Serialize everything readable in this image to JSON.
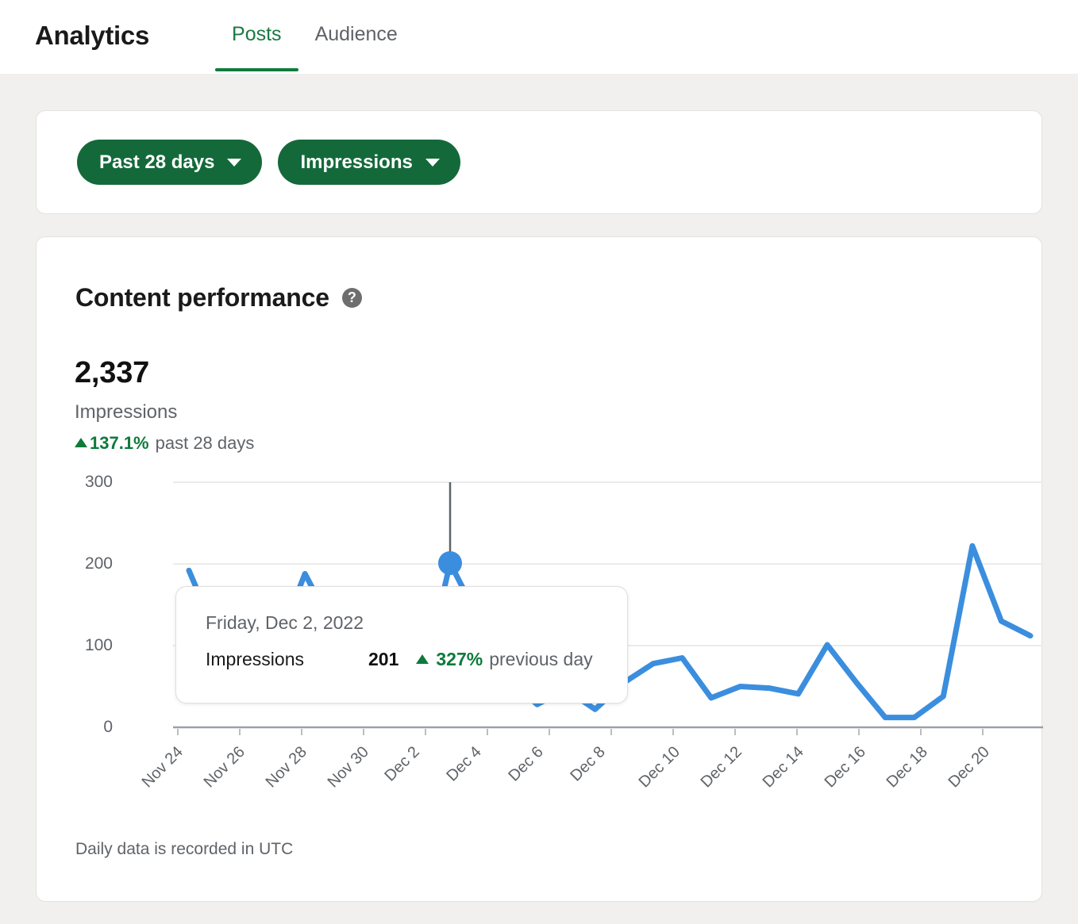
{
  "header": {
    "title": "Analytics",
    "tabs": [
      {
        "label": "Posts",
        "active": true
      },
      {
        "label": "Audience",
        "active": false
      }
    ]
  },
  "filters": {
    "date_range": {
      "label": "Past 28 days",
      "icon": "chevron-down-icon"
    },
    "metric": {
      "label": "Impressions",
      "icon": "chevron-down-icon"
    }
  },
  "performance": {
    "title": "Content performance",
    "help_icon": "help-circle-icon",
    "value": "2,337",
    "metric_label": "Impressions",
    "delta_arrow": "triangle-up-icon",
    "delta_percent": "137.1%",
    "delta_period": "past 28 days",
    "footnote": "Daily data is recorded in UTC"
  },
  "tooltip": {
    "date": "Friday, Dec 2, 2022",
    "metric_label": "Impressions",
    "value": "201",
    "arrow": "triangle-up-icon",
    "delta": "327%",
    "suffix": "previous day"
  },
  "colors": {
    "brand_green": "#14693a",
    "tab_active": "#0f7b3e",
    "line_blue": "#3b8ede",
    "positive_green": "#0e7a3c",
    "page_bg": "#f1f0ee",
    "card_bg": "#ffffff",
    "grid": "#ebebeb",
    "axis": "#9aa0a6",
    "muted_text": "#5f6368"
  },
  "chart_data": {
    "type": "line",
    "title": "Content performance",
    "xlabel": "",
    "ylabel": "Impressions",
    "ylim": [
      0,
      300
    ],
    "yticks": [
      0,
      100,
      200,
      300
    ],
    "grid": true,
    "legend": "none",
    "series": [
      {
        "name": "Impressions",
        "color": "#3b8ede",
        "x": [
          "Nov 23",
          "Nov 24",
          "Nov 25",
          "Nov 26",
          "Nov 27",
          "Nov 28",
          "Nov 29",
          "Nov 30",
          "Dec 1",
          "Dec 2",
          "Dec 3",
          "Dec 4",
          "Dec 5",
          "Dec 6",
          "Dec 7",
          "Dec 8",
          "Dec 9",
          "Dec 10",
          "Dec 11",
          "Dec 12",
          "Dec 13",
          "Dec 14",
          "Dec 15",
          "Dec 16",
          "Dec 17",
          "Dec 18",
          "Dec 19",
          "Dec 20",
          "Dec 21"
        ],
        "values": [
          192,
          108,
          95,
          98,
          188,
          120,
          76,
          64,
          47,
          201,
          132,
          60,
          28,
          46,
          22,
          55,
          78,
          85,
          36,
          50,
          48,
          41,
          101,
          55,
          12,
          12,
          38,
          222,
          130,
          112
        ]
      }
    ],
    "xtick_labels": [
      "Nov 24",
      "Nov 26",
      "Nov 28",
      "Nov 30",
      "Dec 2",
      "Dec 4",
      "Dec 6",
      "Dec 8",
      "Dec 10",
      "Dec 12",
      "Dec 14",
      "Dec 16",
      "Dec 18",
      "Dec 20"
    ],
    "highlight": {
      "x_label": "Dec 2",
      "value": 201,
      "marker": "dot",
      "crosshair": true
    }
  }
}
